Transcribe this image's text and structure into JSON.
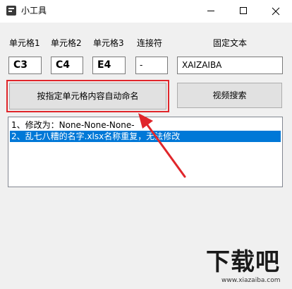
{
  "window": {
    "title": "小工具",
    "icon": "app-icon"
  },
  "labels": {
    "cell1": "单元格1",
    "cell2": "单元格2",
    "cell3": "单元格3",
    "connector": "连接符",
    "fixed_text": "固定文本"
  },
  "inputs": {
    "cell1": "C3",
    "cell2": "C4",
    "cell3": "E4",
    "connector": "-",
    "fixed_text": "XAIZAIBA"
  },
  "buttons": {
    "rename": "按指定单元格内容自动命名",
    "video_search": "视频搜索"
  },
  "log": {
    "items": [
      "1、修改为：None-None-None-",
      "2、乱七八糟的名字.xlsx名称重复，无法修改"
    ],
    "selected_index": 1
  },
  "annotation": {
    "color": "#e0262b"
  },
  "watermark": {
    "text": "下载吧",
    "url": "www.xiazaiba.com"
  },
  "colors": {
    "selection": "#0078d7",
    "annotation_red": "#e0262b"
  }
}
